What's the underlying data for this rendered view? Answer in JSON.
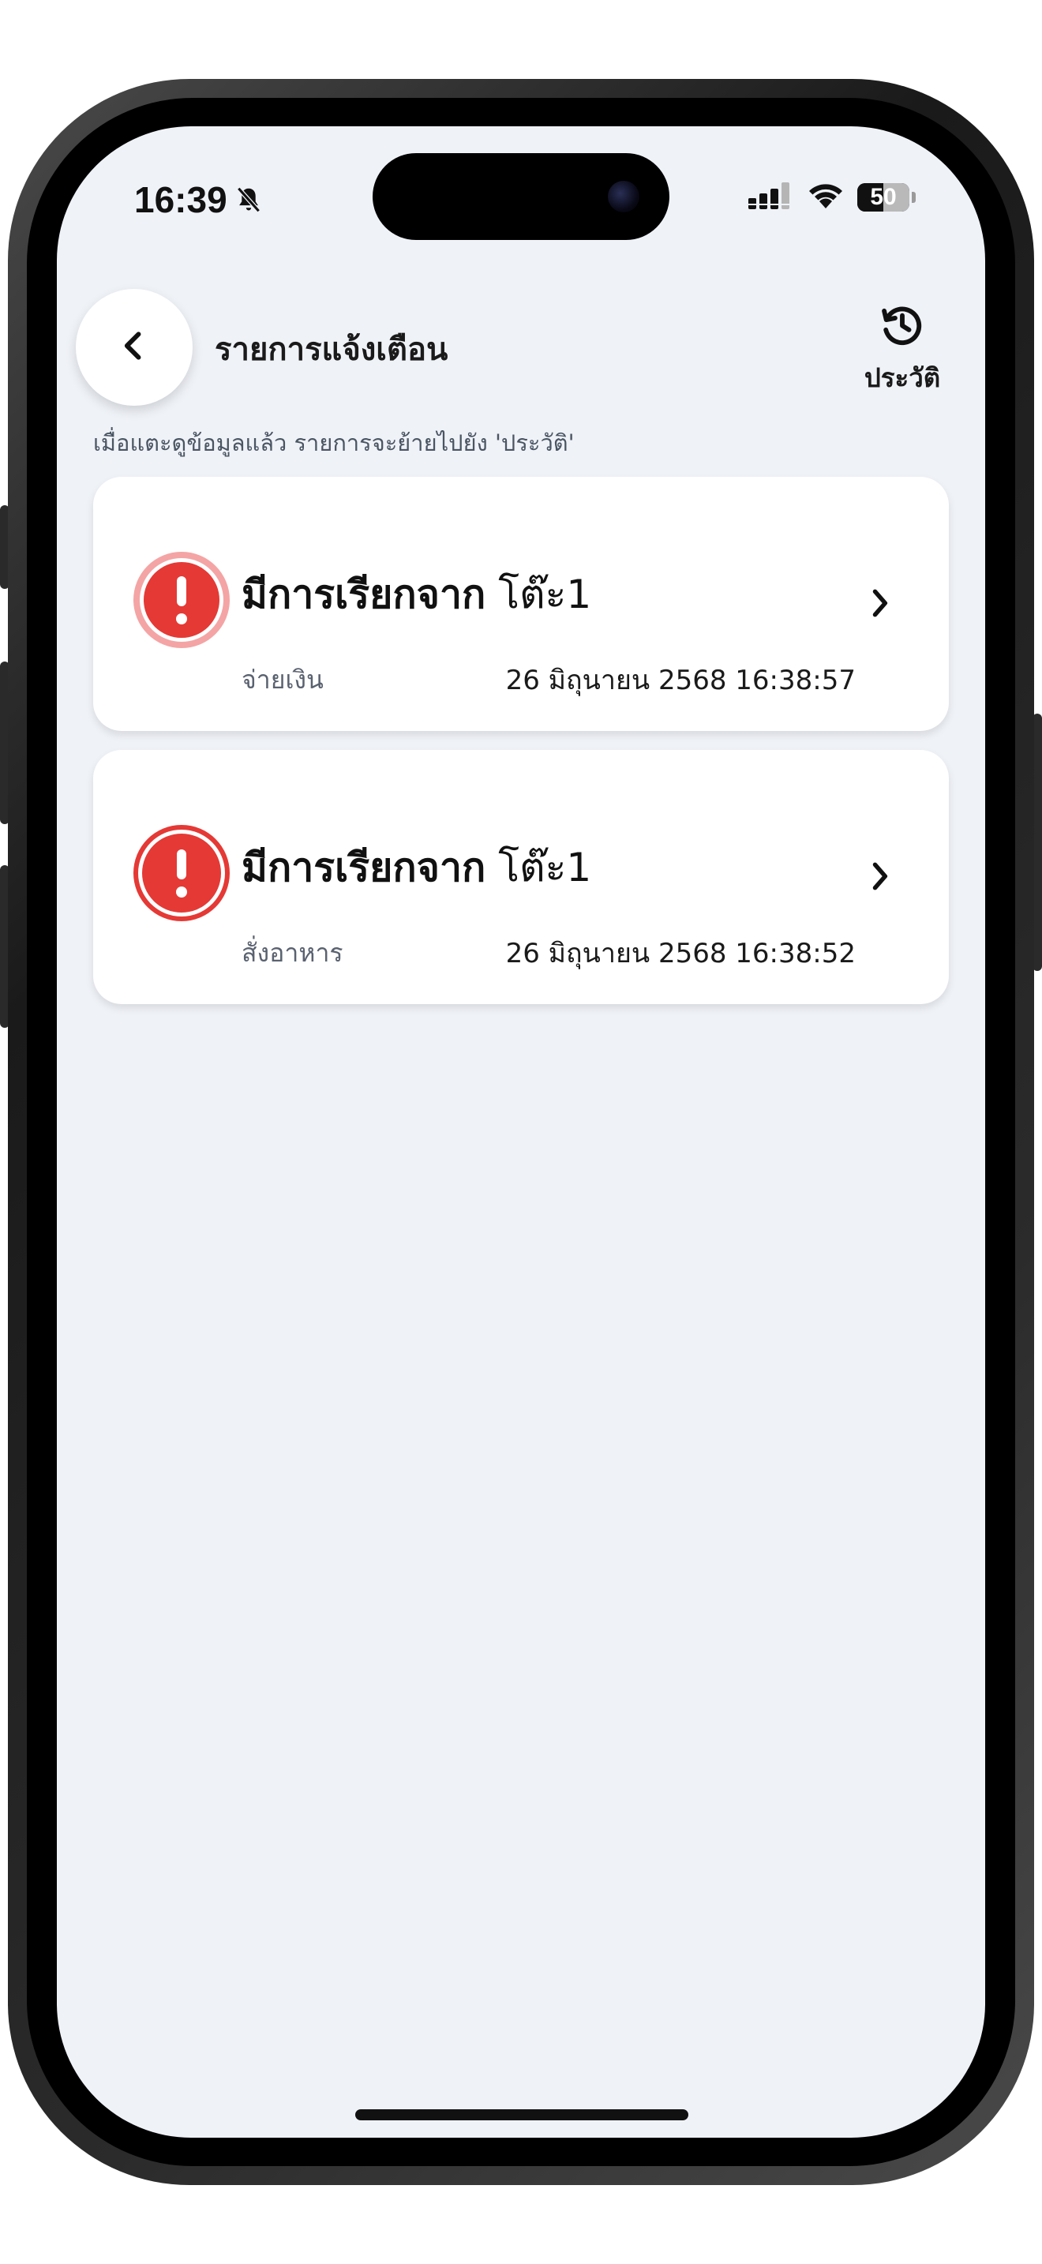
{
  "status_bar": {
    "time": "16:39",
    "battery_percent": "50",
    "battery_level": 0.5
  },
  "header": {
    "title": "รายการแจ้งเตือน",
    "history_label": "ประวัติ"
  },
  "hint": "เมื่อแตะดูข้อมูลแล้ว รายการจะย้ายไปยัง 'ประวัติ'",
  "notifications": [
    {
      "title_main": "มีการเรียกจาก",
      "title_table": "โต๊ะ1",
      "type": "จ่ายเงิน",
      "datetime": "26 มิถุนายน 2568 16:38:57",
      "highlighted": true
    },
    {
      "title_main": "มีการเรียกจาก",
      "title_table": "โต๊ะ1",
      "type": "สั่งอาหาร",
      "datetime": "26 มิถุนายน 2568 16:38:52",
      "highlighted": false
    }
  ],
  "colors": {
    "alert_red": "#e53935",
    "alert_highlight_ring": "#f4a4a4",
    "screen_background": "#eff2f7",
    "card_background": "#ffffff"
  },
  "icons": {
    "back": "chevron-left-icon",
    "history": "history-icon",
    "alert": "alert-exclamation-icon",
    "card_arrow": "chevron-right-icon",
    "mute": "bell-slash-icon",
    "signal": "cellular-signal-icon",
    "wifi": "wifi-icon"
  }
}
